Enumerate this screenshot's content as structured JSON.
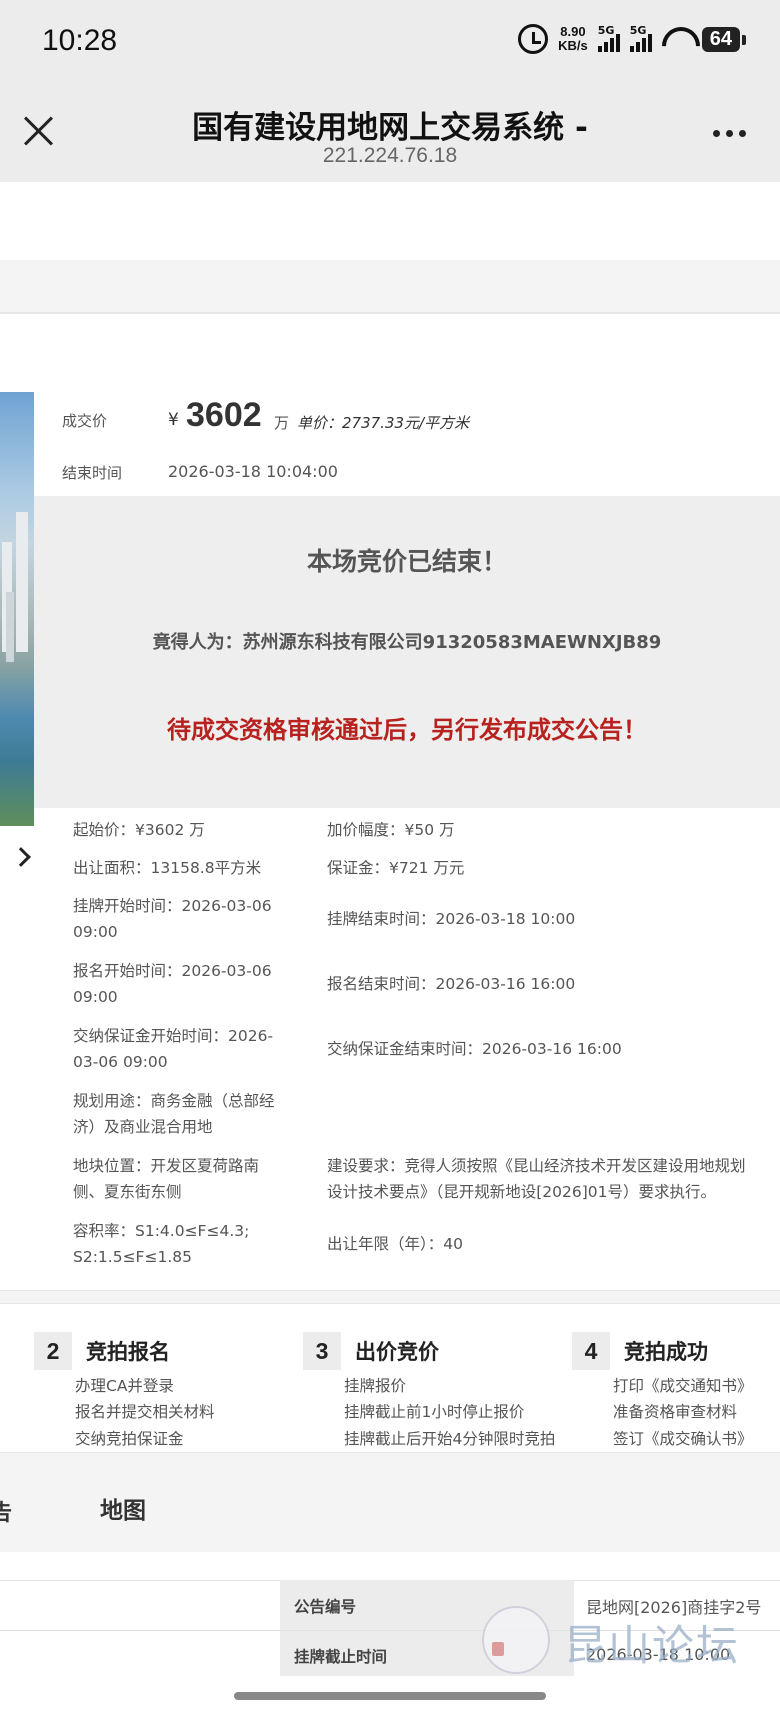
{
  "status_bar": {
    "time": "10:28",
    "net_speed_value": "8.90",
    "net_speed_unit": "KB/s",
    "sim1_label": "5G",
    "sim2_label": "5G",
    "battery": "64"
  },
  "title_bar": {
    "title": "国有建设用地网上交易系统 -",
    "subtitle": "221.224.76.18"
  },
  "deal": {
    "price_label": "成交价",
    "currency": "¥",
    "price_value": "3602",
    "price_unit": "万",
    "unit_price": "单价：2737.33元/平方米",
    "end_time_label": "结束时间",
    "end_time": "2026-03-18 10:04:00"
  },
  "result": {
    "title": "本场竞价已结束！",
    "winner": "竟得人为：苏州源东科技有限公司91320583MAEWNXJB89",
    "notice": "待成交资格审核通过后，另行发布成交公告！"
  },
  "info": {
    "start_price": "起始价：¥3602 万",
    "increment": "加价幅度：¥50 万",
    "area": "出让面积：13158.8平方米",
    "deposit": "保证金：¥721 万元",
    "listing_start_1": "挂牌开始时间：2026-03-06",
    "listing_start_2": "09:00",
    "listing_end": "挂牌结束时间：2026-03-18 10:00",
    "signup_start_1": "报名开始时间：2026-03-06",
    "signup_start_2": "09:00",
    "signup_end": "报名结束时间：2026-03-16 16:00",
    "deposit_start_1": "交纳保证金开始时间：2026-",
    "deposit_start_2": "03-06 09:00",
    "deposit_end": "交纳保证金结束时间：2026-03-16 16:00",
    "usage_1": "规划用途：商务金融（总部经",
    "usage_2": "济）及商业混合用地",
    "location_1": "地块位置：开发区夏荷路南",
    "location_2": "侧、夏东街东侧",
    "requirement_1": "建设要求：竞得人须按照《昆山经济技术开发区建设用地规划",
    "requirement_2": "设计技术要点》（昆开规新地设[2026]01号）要求执行。",
    "far_1": "容积率：S1:4.0≤F≤4.3;",
    "far_2": "S2:1.5≤F≤1.85",
    "term": "出让年限（年）：40"
  },
  "steps": [
    {
      "num": "2",
      "title": "竞拍报名",
      "items": [
        "办理CA并登录",
        "报名并提交相关材料",
        "交纳竞拍保证金"
      ]
    },
    {
      "num": "3",
      "title": "出价竞价",
      "items": [
        "挂牌报价",
        "挂牌截止前1小时停止报价",
        "挂牌截止后开始4分钟限时竞拍"
      ]
    },
    {
      "num": "4",
      "title": "竞拍成功",
      "items": [
        "打印《成交通知书》",
        "准备资格审查材料",
        "签订《成交确认书》"
      ]
    }
  ],
  "tabs": {
    "left_partial": "告",
    "map": "地图"
  },
  "table": {
    "row1_label": "公告编号",
    "row1_value": "昆地网[2026]商挂字2号",
    "row2_label": "挂牌截止时间",
    "row2_value": "2026-03-18 10:00"
  },
  "watermark": {
    "text": "昆山论坛"
  }
}
